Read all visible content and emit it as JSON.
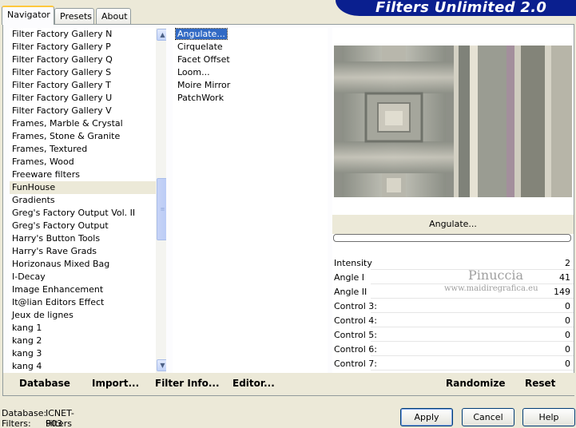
{
  "tabs": [
    "Navigator",
    "Presets",
    "About"
  ],
  "app_title": "Filters Unlimited 2.0",
  "categories": [
    "Filter Factory Gallery N",
    "Filter Factory Gallery P",
    "Filter Factory Gallery Q",
    "Filter Factory Gallery S",
    "Filter Factory Gallery T",
    "Filter Factory Gallery U",
    "Filter Factory Gallery V",
    "Frames, Marble & Crystal",
    "Frames, Stone & Granite",
    "Frames, Textured",
    "Frames, Wood",
    "Freeware filters",
    "FunHouse",
    "Gradients",
    "Greg's Factory Output Vol. II",
    "Greg's Factory Output",
    "Harry's Button Tools",
    "Harry's Rave Grads",
    "Horizonaus Mixed Bag",
    "I-Decay",
    "Image Enhancement",
    "It@lian Editors Effect",
    "Jeux de lignes",
    "kang 1",
    "kang 2",
    "kang 3",
    "kang 4"
  ],
  "filters": [
    "Angulate...",
    "Cirquelate",
    "Facet Offset",
    "Loom...",
    "Moire Mirror",
    "PatchWork"
  ],
  "selected_filter_label": "Angulate...",
  "controls": [
    {
      "label": "Intensity",
      "value": "2"
    },
    {
      "label": "Angle I",
      "value": "41"
    },
    {
      "label": "Angle II",
      "value": "149"
    },
    {
      "label": "Control 3:",
      "value": "0"
    },
    {
      "label": "Control 4:",
      "value": "0"
    },
    {
      "label": "Control 5:",
      "value": "0"
    },
    {
      "label": "Control 6:",
      "value": "0"
    },
    {
      "label": "Control 7:",
      "value": "0"
    }
  ],
  "watermark": {
    "name": "Pinuccia",
    "url": "www.maidiregrafica.eu"
  },
  "bottom_links": {
    "database": "Database",
    "import": "Import...",
    "filter_info": "Filter Info...",
    "editor": "Editor...",
    "randomize": "Randomize",
    "reset": "Reset"
  },
  "status": {
    "database_label": "Database:",
    "database_value": "ICNET-Filters",
    "filters_label": "Filters:",
    "filters_value": "903"
  },
  "buttons": {
    "apply": "Apply",
    "cancel": "Cancel",
    "help": "Help"
  }
}
